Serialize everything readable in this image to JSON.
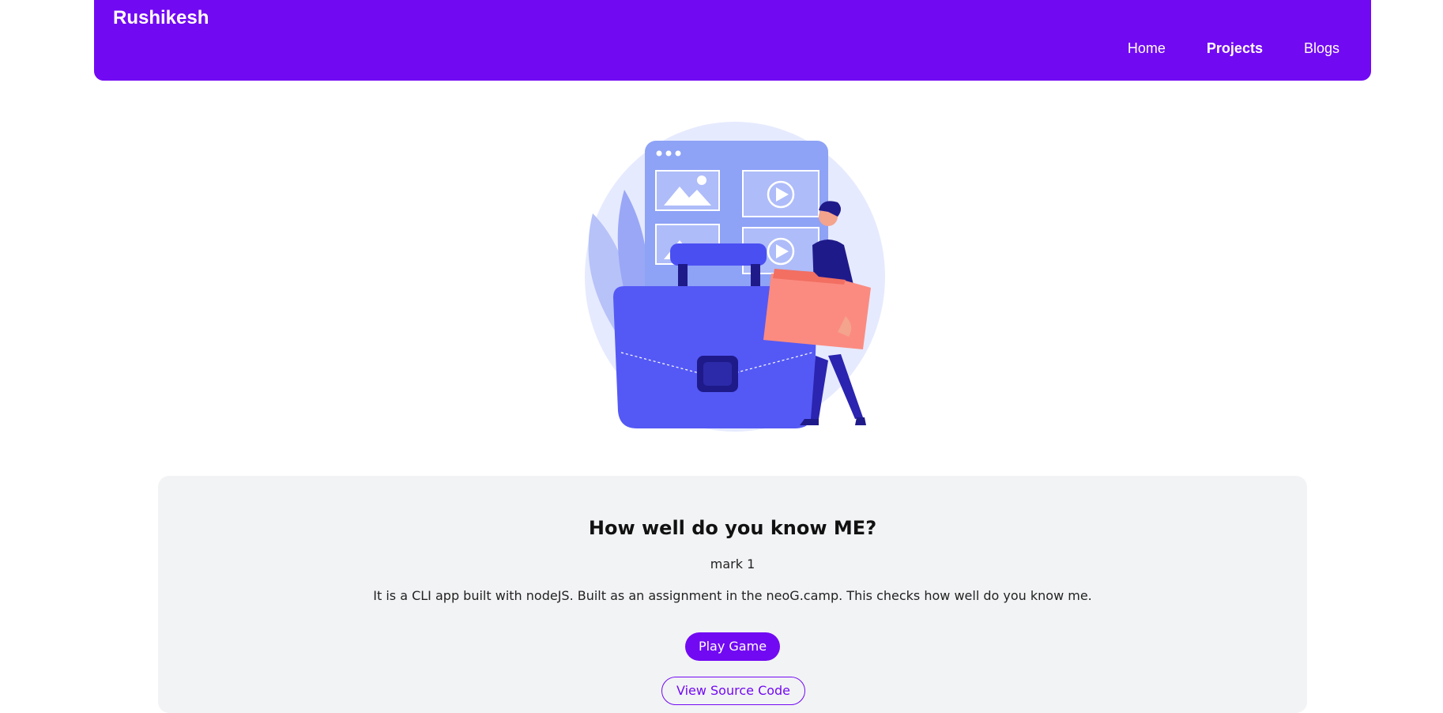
{
  "navbar": {
    "brand": "Rushikesh",
    "links": [
      {
        "label": "Home"
      },
      {
        "label": "Projects"
      },
      {
        "label": "Blogs"
      }
    ],
    "colors": {
      "background": "#7209f3",
      "text": "#ffffff"
    }
  },
  "hero": {
    "illustration": "person-with-briefcase-and-folder-illustration",
    "colors": {
      "primary": "#5459f5",
      "accent": "#fb8b80",
      "light": "#e6eafe",
      "dark": "#1f1a8a"
    }
  },
  "project": {
    "title": "How well do you know ME?",
    "subtitle": "mark 1",
    "description": "It is a CLI app built with nodeJS. Built as an assignment in the neoG.camp. This checks how well do you know me.",
    "primary_button": "Play Game",
    "secondary_button": "View Source Code",
    "colors": {
      "card_bg": "#f2f3f5",
      "accent": "#7209f3"
    }
  }
}
